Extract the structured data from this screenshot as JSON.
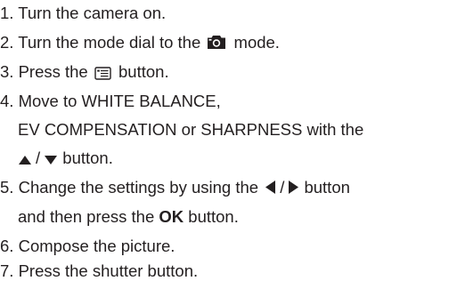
{
  "steps": [
    {
      "num": "1.",
      "text": "Turn the camera on."
    },
    {
      "num": "2.",
      "pre": "Turn the mode dial to the",
      "icon": "camera-icon",
      "post": "mode."
    },
    {
      "num": "3.",
      "pre": "Press the",
      "icon": "menu-icon",
      "post": "button."
    },
    {
      "num": "4.",
      "lines": [
        "Move to WHITE BALANCE,",
        "EV COMPENSATION or SHARPNESS with the"
      ],
      "icons": [
        "up-triangle-icon",
        "down-triangle-icon"
      ],
      "separator": "/",
      "post": "button."
    },
    {
      "num": "5.",
      "pre": "Change the settings by using the",
      "icons": [
        "left-triangle-icon",
        "right-triangle-icon"
      ],
      "separator": "/",
      "post": "button",
      "line2_pre": "and then press the",
      "line2_bold": "OK",
      "line2_post": "button."
    },
    {
      "num": "6.",
      "text": "Compose the picture."
    },
    {
      "num": "7.",
      "text": "Press the shutter button."
    }
  ]
}
